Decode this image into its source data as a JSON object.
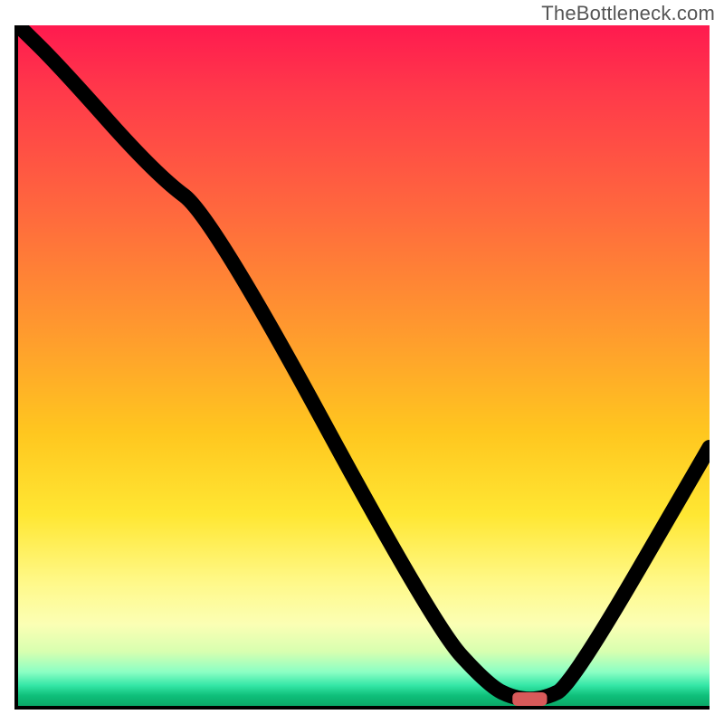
{
  "watermark": "TheBottleneck.com",
  "chart_data": {
    "type": "line",
    "title": "",
    "xlabel": "",
    "ylabel": "",
    "xlim": [
      0,
      100
    ],
    "ylim": [
      0,
      100
    ],
    "grid": false,
    "legend": false,
    "background_gradient": {
      "stops": [
        {
          "pos": 0,
          "color": "#ff1a4f",
          "meaning": "worst"
        },
        {
          "pos": 0.5,
          "color": "#ff9a2e"
        },
        {
          "pos": 0.72,
          "color": "#ffe733"
        },
        {
          "pos": 0.88,
          "color": "#fbffb4"
        },
        {
          "pos": 0.97,
          "color": "#34e6a6"
        },
        {
          "pos": 1.0,
          "color": "#0aa868",
          "meaning": "best"
        }
      ]
    },
    "series": [
      {
        "name": "bottleneck-curve",
        "x": [
          0,
          6,
          20,
          28,
          60,
          68,
          72,
          76,
          80,
          100
        ],
        "values": [
          100,
          94,
          78,
          72,
          12,
          3,
          1,
          1,
          3,
          38
        ]
      }
    ],
    "marker": {
      "name": "optimal-point",
      "x": 74,
      "y": 1,
      "width": 5,
      "color": "#d85a5a"
    }
  }
}
